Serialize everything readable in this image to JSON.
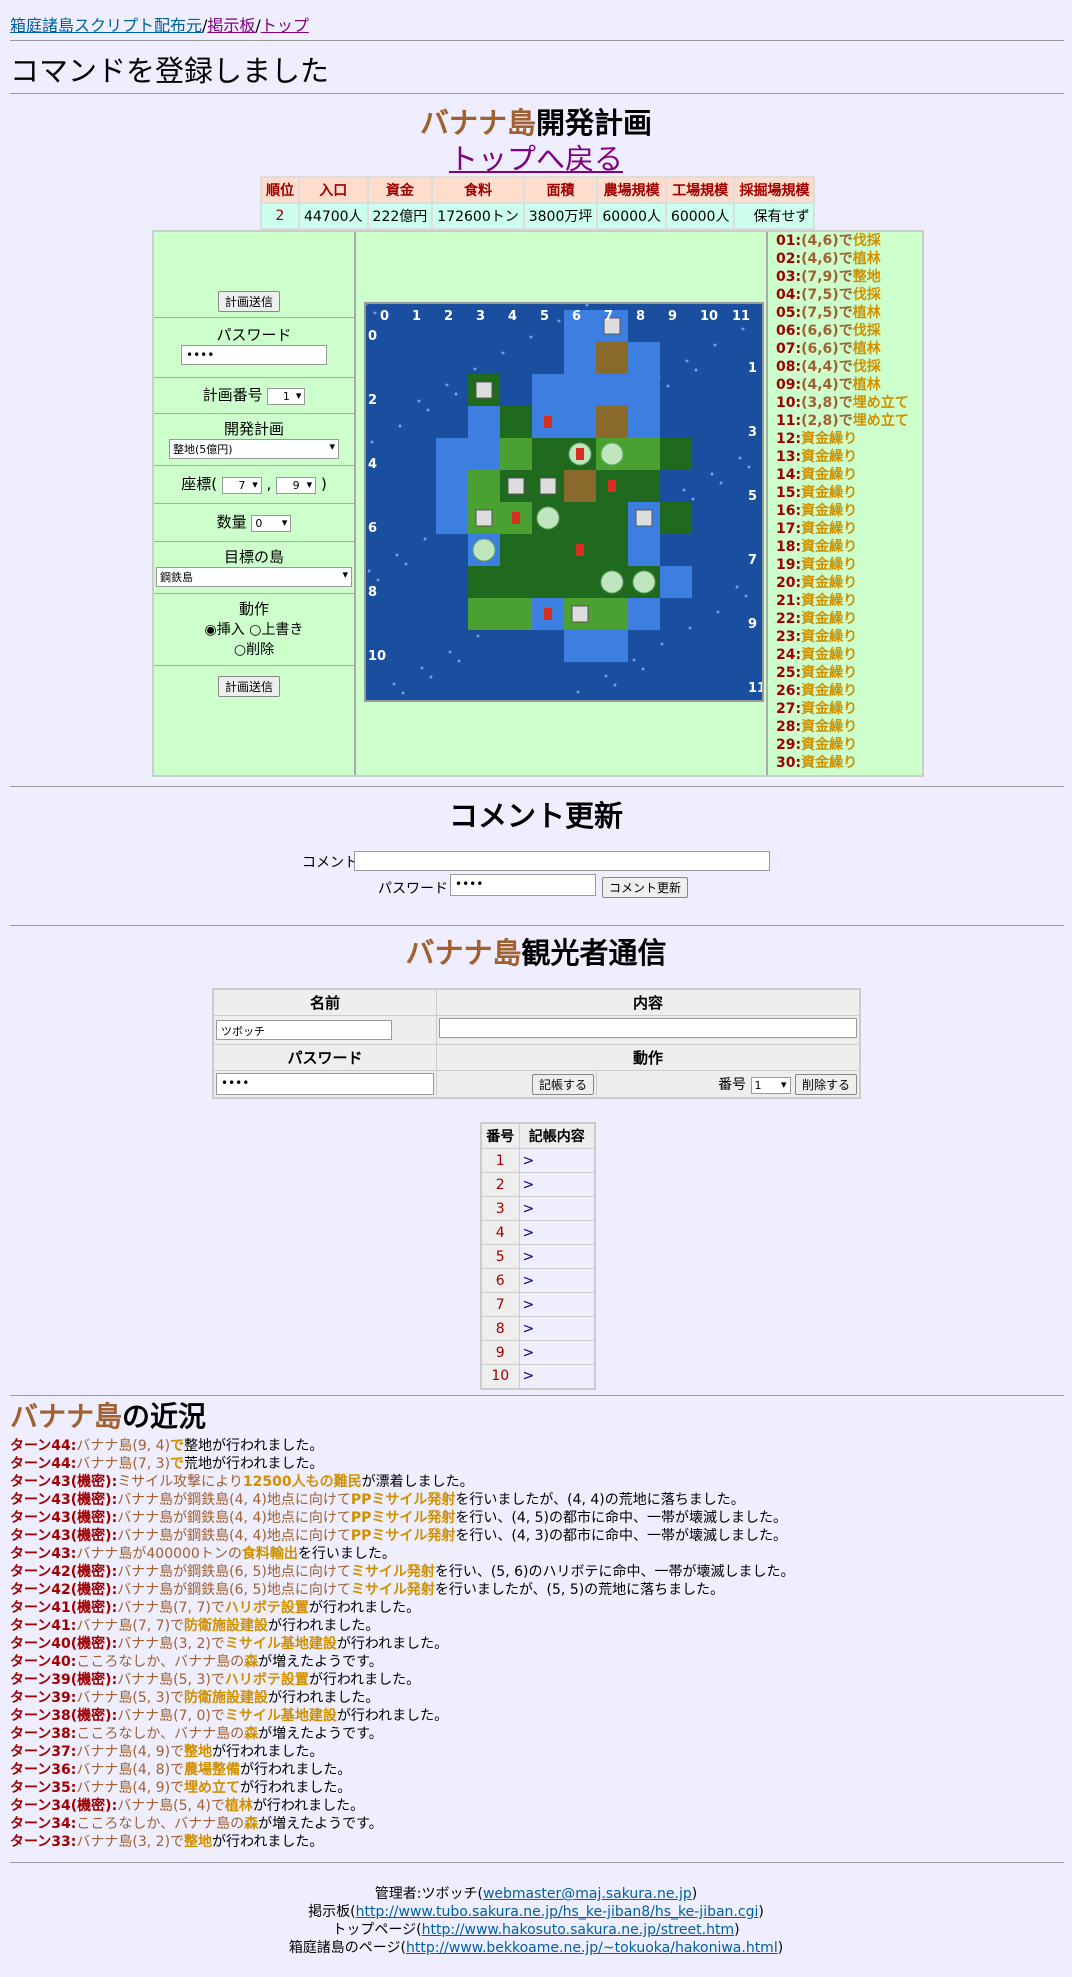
{
  "breadcrumbs": {
    "link1": "箱庭諸島スクリプト配布元",
    "link2": "掲示板",
    "link3": "トップ"
  },
  "message": "コマンドを登録しました",
  "plan": {
    "island": "バナナ島",
    "title_suffix": "開発計画",
    "back_link": "トップへ戻る"
  },
  "status": {
    "headers": [
      "順位",
      "入口",
      "資金",
      "食料",
      "面積",
      "農場規模",
      "工場規模",
      "採掘場規模"
    ],
    "values": [
      "2",
      "44700人",
      "222億円",
      "172600トン",
      "3800万坪",
      "60000人",
      "60000人",
      "保有せず"
    ]
  },
  "form": {
    "submit": "計画送信",
    "password_label": "パスワード",
    "password_value": "••••",
    "plan_no_label": "計画番号",
    "plan_no": "1",
    "dev_label": "開発計画",
    "dev_value": "整地(5億円)",
    "coord_label_open": "座標(",
    "coord_x": "7",
    "coord_sep": ",",
    "coord_y": "9",
    "coord_label_close": ")",
    "qty_label": "数量",
    "qty_value": "0",
    "target_label": "目標の島",
    "target_value": "鋼鉄島",
    "action_label": "動作",
    "opt_insert": "挿入",
    "opt_overwrite": "上書き",
    "opt_delete": "削除"
  },
  "map": {
    "col_labels": [
      "0",
      "1",
      "2",
      "3",
      "4",
      "5",
      "6",
      "7",
      "8",
      "9",
      "10",
      "11"
    ],
    "row_labels": [
      "0",
      "1",
      "2",
      "3",
      "4",
      "5",
      "6",
      "7",
      "8",
      "9",
      "10",
      "11"
    ]
  },
  "commands": [
    {
      "n": "01:",
      "c": "(4,6)",
      "m": "で",
      "k": "伐採"
    },
    {
      "n": "02:",
      "c": "(4,6)",
      "m": "で",
      "k": "植林"
    },
    {
      "n": "03:",
      "c": "(7,9)",
      "m": "で",
      "k": "整地"
    },
    {
      "n": "04:",
      "c": "(7,5)",
      "m": "で",
      "k": "伐採"
    },
    {
      "n": "05:",
      "c": "(7,5)",
      "m": "で",
      "k": "植林"
    },
    {
      "n": "06:",
      "c": "(6,6)",
      "m": "で",
      "k": "伐採"
    },
    {
      "n": "07:",
      "c": "(6,6)",
      "m": "で",
      "k": "植林"
    },
    {
      "n": "08:",
      "c": "(4,4)",
      "m": "で",
      "k": "伐採"
    },
    {
      "n": "09:",
      "c": "(4,4)",
      "m": "で",
      "k": "植林"
    },
    {
      "n": "10:",
      "c": "(3,8)",
      "m": "で",
      "k": "埋め立て"
    },
    {
      "n": "11:",
      "c": "(2,8)",
      "m": "で",
      "k": "埋め立て"
    },
    {
      "n": "12:",
      "c": "",
      "m": "",
      "k": "資金繰り"
    },
    {
      "n": "13:",
      "c": "",
      "m": "",
      "k": "資金繰り"
    },
    {
      "n": "14:",
      "c": "",
      "m": "",
      "k": "資金繰り"
    },
    {
      "n": "15:",
      "c": "",
      "m": "",
      "k": "資金繰り"
    },
    {
      "n": "16:",
      "c": "",
      "m": "",
      "k": "資金繰り"
    },
    {
      "n": "17:",
      "c": "",
      "m": "",
      "k": "資金繰り"
    },
    {
      "n": "18:",
      "c": "",
      "m": "",
      "k": "資金繰り"
    },
    {
      "n": "19:",
      "c": "",
      "m": "",
      "k": "資金繰り"
    },
    {
      "n": "20:",
      "c": "",
      "m": "",
      "k": "資金繰り"
    },
    {
      "n": "21:",
      "c": "",
      "m": "",
      "k": "資金繰り"
    },
    {
      "n": "22:",
      "c": "",
      "m": "",
      "k": "資金繰り"
    },
    {
      "n": "23:",
      "c": "",
      "m": "",
      "k": "資金繰り"
    },
    {
      "n": "24:",
      "c": "",
      "m": "",
      "k": "資金繰り"
    },
    {
      "n": "25:",
      "c": "",
      "m": "",
      "k": "資金繰り"
    },
    {
      "n": "26:",
      "c": "",
      "m": "",
      "k": "資金繰り"
    },
    {
      "n": "27:",
      "c": "",
      "m": "",
      "k": "資金繰り"
    },
    {
      "n": "28:",
      "c": "",
      "m": "",
      "k": "資金繰り"
    },
    {
      "n": "29:",
      "c": "",
      "m": "",
      "k": "資金繰り"
    },
    {
      "n": "30:",
      "c": "",
      "m": "",
      "k": "資金繰り"
    }
  ],
  "comment": {
    "title": "コメント更新",
    "comment_label": "コメント",
    "password_label": "パスワード",
    "password_value": "••••",
    "button": "コメント更新"
  },
  "visitor": {
    "island": "バナナ島",
    "title_suffix": "観光者通信",
    "name_header": "名前",
    "content_header": "内容",
    "name_value": "ツボッチ",
    "password_header": "パスワード",
    "action_header": "動作",
    "password_value": "••••",
    "write_button": "記帳する",
    "number_label": "番号",
    "number_value": "1",
    "delete_button": "削除する"
  },
  "log": {
    "h1": "番号",
    "h2": "記帳内容",
    "rows": [
      "1",
      "2",
      "3",
      "4",
      "5",
      "6",
      "7",
      "8",
      "9",
      "10"
    ],
    "mark": ">"
  },
  "news": {
    "island": "バナナ島",
    "suffix": "の近況",
    "lines": [
      "ターン44:|バナナ島(9, 4)|で|整地|が行われました。",
      "ターン44:|バナナ島(7, 3)|で|荒地|が行われました。",
      "ターン43(機密):|ミサイル攻撃により|12500人もの難民|が漂着しました。",
      "ターン43(機密):|バナナ島が鋼鉄島(4, 4)地点に向けて|PPミサイル発射|を行いましたが、(4, 4)の荒地に落ちました。",
      "ターン43(機密):|バナナ島が鋼鉄島(4, 4)地点に向けて|PPミサイル発射|を行い、(4, 5)の都市に命中、一帯が壊滅しました。",
      "ターン43(機密):|バナナ島が鋼鉄島(4, 4)地点に向けて|PPミサイル発射|を行い、(4, 3)の都市に命中、一帯が壊滅しました。",
      "ターン43:|バナナ島が400000トンの|食料輸出|を行いました。",
      "ターン42(機密):|バナナ島が鋼鉄島(6, 5)地点に向けて|ミサイル発射|を行い、(5, 6)のハリボテに命中、一帯が壊滅しました。",
      "ターン42(機密):|バナナ島が鋼鉄島(6, 5)地点に向けて|ミサイル発射|を行いましたが、(5, 5)の荒地に落ちました。",
      "ターン41(機密):|バナナ島(7, 7)で|ハリボテ設置|が行われました。",
      "ターン41:|バナナ島(7, 7)で|防衛施設建設|が行われました。",
      "ターン40(機密):|バナナ島(3, 2)で|ミサイル基地建設|が行われました。",
      "ターン40:|こころなしか、バナナ島の|森|が増えたようです。",
      "ターン39(機密):|バナナ島(5, 3)で|ハリボテ設置|が行われました。",
      "ターン39:|バナナ島(5, 3)で|防衛施設建設|が行われました。",
      "ターン38(機密):|バナナ島(7, 0)で|ミサイル基地建設|が行われました。",
      "ターン38:|こころなしか、バナナ島の|森|が増えたようです。",
      "ターン37:|バナナ島(4, 9)で|整地|が行われました。",
      "ターン36:|バナナ島(4, 8)で|農場整備|が行われました。",
      "ターン35:|バナナ島(4, 9)で|埋め立て|が行われました。",
      "ターン34(機密):|バナナ島(5, 4)で|植林|が行われました。",
      "ターン34:|こころなしか、バナナ島の|森|が増えたようです。",
      "ターン33:|バナナ島(3, 2)で|整地|が行われました。"
    ]
  },
  "footer": {
    "admin": "管理者:ツボッチ(",
    "admin_mail": "webmaster@maj.sakura.ne.jp",
    "admin_end": ")",
    "bbs": "掲示板(",
    "bbs_url": "http://www.tubo.sakura.ne.jp/hs_ke-jiban8/hs_ke-jiban.cgi",
    "bbs_end": ")",
    "top": "トップページ(",
    "top_url": "http://www.hakosuto.sakura.ne.jp/street.htm",
    "top_end": ")",
    "hako": "箱庭諸島のページ(",
    "hako_url": "http://www.bekkoame.ne.jp/~tokuoka/hakoniwa.html",
    "hako_end": ")"
  }
}
